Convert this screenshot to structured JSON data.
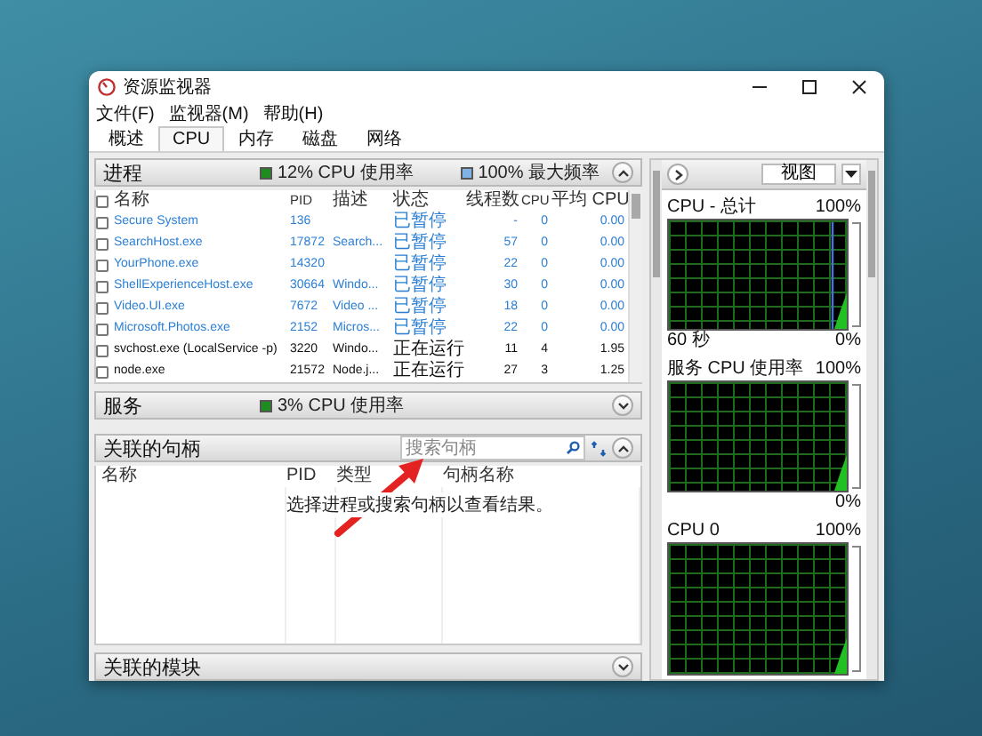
{
  "window": {
    "title": "资源监视器"
  },
  "menu": [
    {
      "label": "文件(F)"
    },
    {
      "label": "监视器(M)"
    },
    {
      "label": "帮助(H)"
    }
  ],
  "tabs": [
    {
      "label": "概述",
      "selected": false
    },
    {
      "label": "CPU",
      "selected": true
    },
    {
      "label": "内存",
      "selected": false
    },
    {
      "label": "磁盘",
      "selected": false
    },
    {
      "label": "网络",
      "selected": false
    }
  ],
  "processes": {
    "title": "进程",
    "expanded": true,
    "stats": [
      {
        "text": "12% CPU 使用率",
        "color": "#1e8c1e"
      },
      {
        "text": "100% 最大频率",
        "color": "#7fb2e5"
      }
    ],
    "select_all": {
      "checked": false
    },
    "columns": [
      "名称",
      "PID",
      "描述",
      "状态",
      "线程数",
      "CPU",
      "平均 CPU"
    ],
    "rows": [
      {
        "name": "Secure System",
        "pid": "136",
        "status": "已暂停",
        "threads": "-",
        "cpu": "0",
        "avg_cpu": "0.00",
        "suspended": true,
        "checked": false
      },
      {
        "name": "SearchHost.exe",
        "pid": "17872",
        "description": "Search...",
        "status": "已暂停",
        "threads": "57",
        "cpu": "0",
        "avg_cpu": "0.00",
        "suspended": true,
        "checked": false
      },
      {
        "name": "YourPhone.exe",
        "pid": "14320",
        "status": "已暂停",
        "threads": "22",
        "cpu": "0",
        "avg_cpu": "0.00",
        "suspended": true,
        "checked": false
      },
      {
        "name": "ShellExperienceHost.exe",
        "pid": "30664",
        "description": "Windo...",
        "status": "已暂停",
        "threads": "30",
        "cpu": "0",
        "avg_cpu": "0.00",
        "suspended": true,
        "checked": false
      },
      {
        "name": "Video.UI.exe",
        "pid": "7672",
        "description": "Video ...",
        "status": "已暂停",
        "threads": "18",
        "cpu": "0",
        "avg_cpu": "0.00",
        "suspended": true,
        "checked": false
      },
      {
        "name": "Microsoft.Photos.exe",
        "pid": "2152",
        "description": "Micros...",
        "status": "已暂停",
        "threads": "22",
        "cpu": "0",
        "avg_cpu": "0.00",
        "suspended": true,
        "checked": false
      },
      {
        "name": "svchost.exe (LocalService -p)",
        "pid": "3220",
        "description": "Windo...",
        "status": "正在运行",
        "threads": "11",
        "cpu": "4",
        "avg_cpu": "1.95",
        "suspended": false,
        "checked": false
      },
      {
        "name": "node.exe",
        "pid": "21572",
        "description": "Node.j...",
        "status": "正在运行",
        "threads": "27",
        "cpu": "3",
        "avg_cpu": "1.25",
        "suspended": false,
        "checked": false
      }
    ]
  },
  "services": {
    "title": "服务",
    "expanded": false,
    "stats": [
      {
        "text": "3% CPU 使用率",
        "color": "#1e8c1e"
      }
    ]
  },
  "handles": {
    "title": "关联的句柄",
    "expanded": true,
    "search": {
      "placeholder": "搜索句柄"
    },
    "columns": [
      "名称",
      "PID",
      "类型",
      "句柄名称"
    ],
    "message": "选择进程或搜索句柄以查看结果。"
  },
  "modules": {
    "title": "关联的模块",
    "expanded": false
  },
  "graphs_pane": {
    "view_button": "视图",
    "graphs": [
      {
        "title": "CPU - 总计",
        "max": "100%",
        "time": "60 秒",
        "min": "0%"
      },
      {
        "title": "服务 CPU 使用率",
        "max": "100%",
        "min": "0%"
      },
      {
        "title": "CPU 0",
        "max": "100%"
      }
    ]
  }
}
